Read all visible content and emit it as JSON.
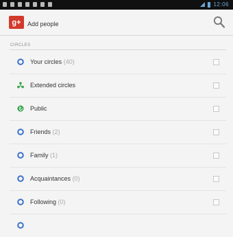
{
  "status": {
    "time": "12:06"
  },
  "header": {
    "logo": "g+",
    "title": "Add people"
  },
  "section": {
    "title": "CIRCLES"
  },
  "circles": [
    {
      "label": "Your circles",
      "count": "(40)",
      "icon": "circle-icon"
    },
    {
      "label": "Extended circles",
      "count": "",
      "icon": "extended-circles-icon"
    },
    {
      "label": "Public",
      "count": "",
      "icon": "public-icon"
    },
    {
      "label": "Friends",
      "count": "(2)",
      "icon": "circle-icon"
    },
    {
      "label": "Family",
      "count": "(1)",
      "icon": "circle-icon"
    },
    {
      "label": "Acquaintances",
      "count": "(0)",
      "icon": "circle-icon"
    },
    {
      "label": "Following",
      "count": "(0)",
      "icon": "circle-icon"
    }
  ],
  "colors": {
    "circle": "#3b73c8",
    "extended": "#3aa34b",
    "public": "#2fa24a",
    "brand": "#d23a2b"
  }
}
